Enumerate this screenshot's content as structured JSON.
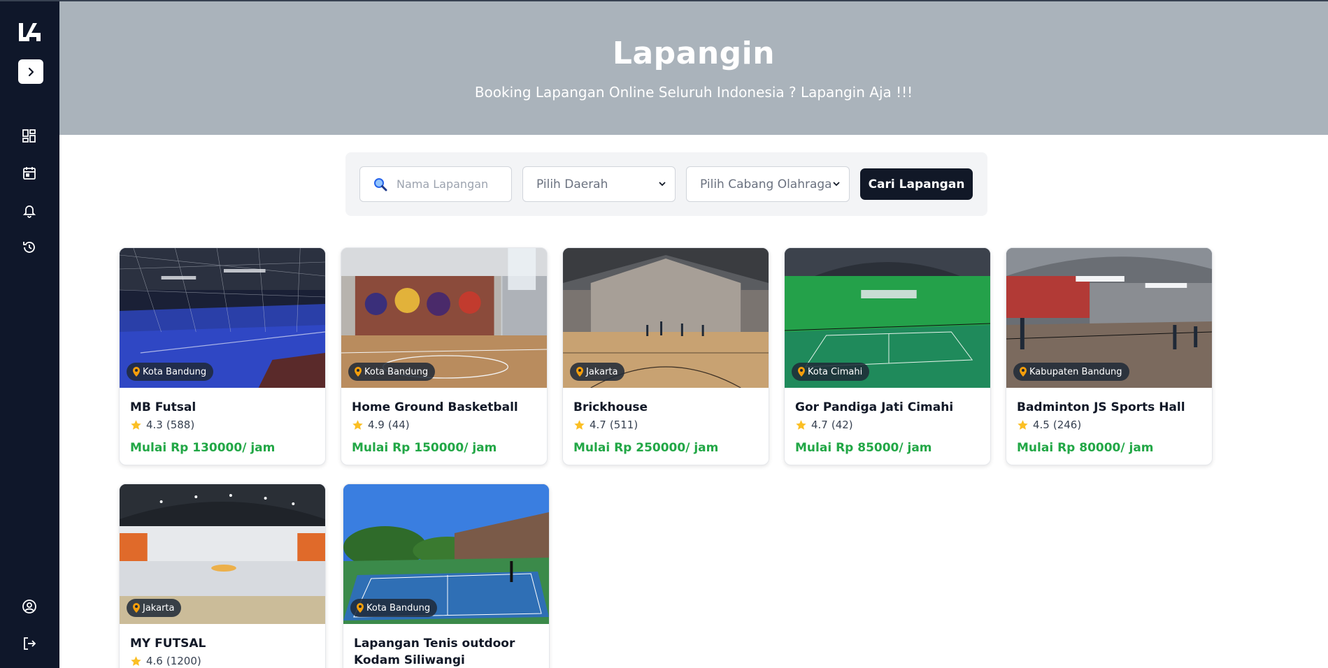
{
  "app": {
    "title": "Lapangin",
    "subtitle": "Booking Lapangan Online Seluruh Indonesia ? Lapangin Aja !!!"
  },
  "sidebar": {
    "logo": "logo-mark",
    "expand_icon": "chevron-right-icon",
    "items": [
      {
        "icon": "dashboard-icon"
      },
      {
        "icon": "calendar-icon"
      },
      {
        "icon": "bell-icon"
      },
      {
        "icon": "history-icon"
      },
      {
        "icon": "user-circle-icon"
      },
      {
        "icon": "logout-icon"
      }
    ]
  },
  "search": {
    "placeholder": "Nama Lapangan",
    "daerah_label": "Pilih Daerah",
    "cabang_label": "Pilih Cabang Olahraga",
    "button_label": "Cari Lapangan"
  },
  "colors": {
    "sidebar_bg": "#0f172a",
    "hero_bg": "#aab3bb",
    "price": "#22a746",
    "star": "#fbbf24",
    "pin": "#f59e0b"
  },
  "venues": [
    {
      "name": "MB Futsal",
      "location": "Kota Bandung",
      "rating": "4.3",
      "reviews": "(588)",
      "price": "Mulai Rp 130000/ jam"
    },
    {
      "name": "Home Ground Basketball",
      "location": "Kota Bandung",
      "rating": "4.9",
      "reviews": "(44)",
      "price": "Mulai Rp 150000/ jam"
    },
    {
      "name": "Brickhouse",
      "location": "Jakarta",
      "rating": "4.7",
      "reviews": "(511)",
      "price": "Mulai Rp 250000/ jam"
    },
    {
      "name": "Gor Pandiga Jati Cimahi",
      "location": "Kota Cimahi",
      "rating": "4.7",
      "reviews": "(42)",
      "price": "Mulai Rp 85000/ jam"
    },
    {
      "name": "Badminton JS Sports Hall",
      "location": "Kabupaten Bandung",
      "rating": "4.5",
      "reviews": "(246)",
      "price": "Mulai Rp 80000/ jam"
    },
    {
      "name": "MY FUTSAL",
      "location": "Jakarta",
      "rating": "4.6",
      "reviews": "(1200)",
      "price": ""
    },
    {
      "name": "Lapangan Tenis outdoor Kodam Siliwangi",
      "location": "Kota Bandung",
      "rating": "",
      "reviews": "",
      "price": ""
    }
  ]
}
